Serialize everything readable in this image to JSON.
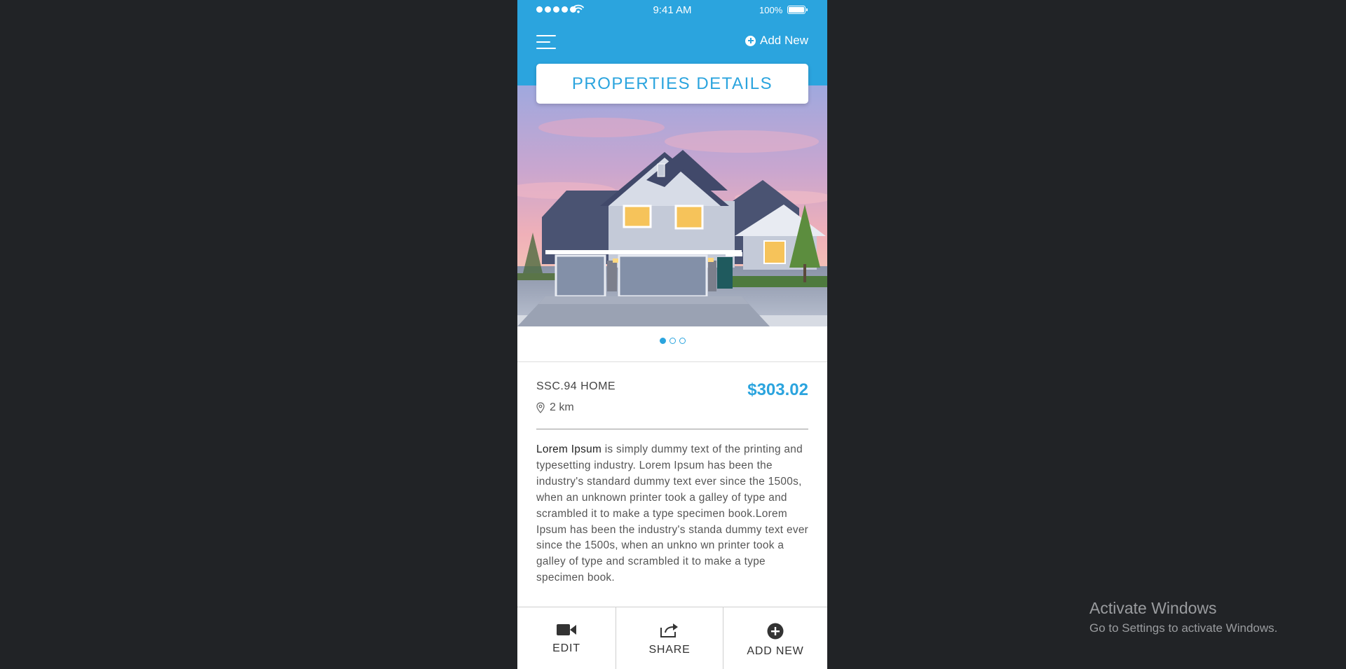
{
  "status_bar": {
    "time": "9:41 AM",
    "battery": "100%"
  },
  "header": {
    "add_new_label": "Add New",
    "title": "PROPERTIES DETAILS"
  },
  "property": {
    "name": "SSC.94 HOME",
    "price": "$303.02",
    "distance": "2 km",
    "description_lead": "Lorem Ipsum",
    "description_rest": " is simply dummy text of the printing and typesetting industry. Lorem Ipsum has been the industry's standard dummy text ever since the 1500s, when an unknown printer took a galley of type and scrambled it to make a type specimen book.Lorem Ipsum has been the industry's standa dummy text ever since the 1500s, when an unkno wn printer took a galley of type and scrambled it to make a type specimen book."
  },
  "carousel": {
    "count": 3,
    "active_index": 0
  },
  "bottom_bar": {
    "edit_label": "EDIT",
    "share_label": "SHARE",
    "add_new_label": "ADD NEW"
  },
  "watermark": {
    "title": "Activate Windows",
    "subtitle": "Go to Settings to activate Windows."
  },
  "colors": {
    "accent": "#2ba4de",
    "background": "#212326"
  }
}
